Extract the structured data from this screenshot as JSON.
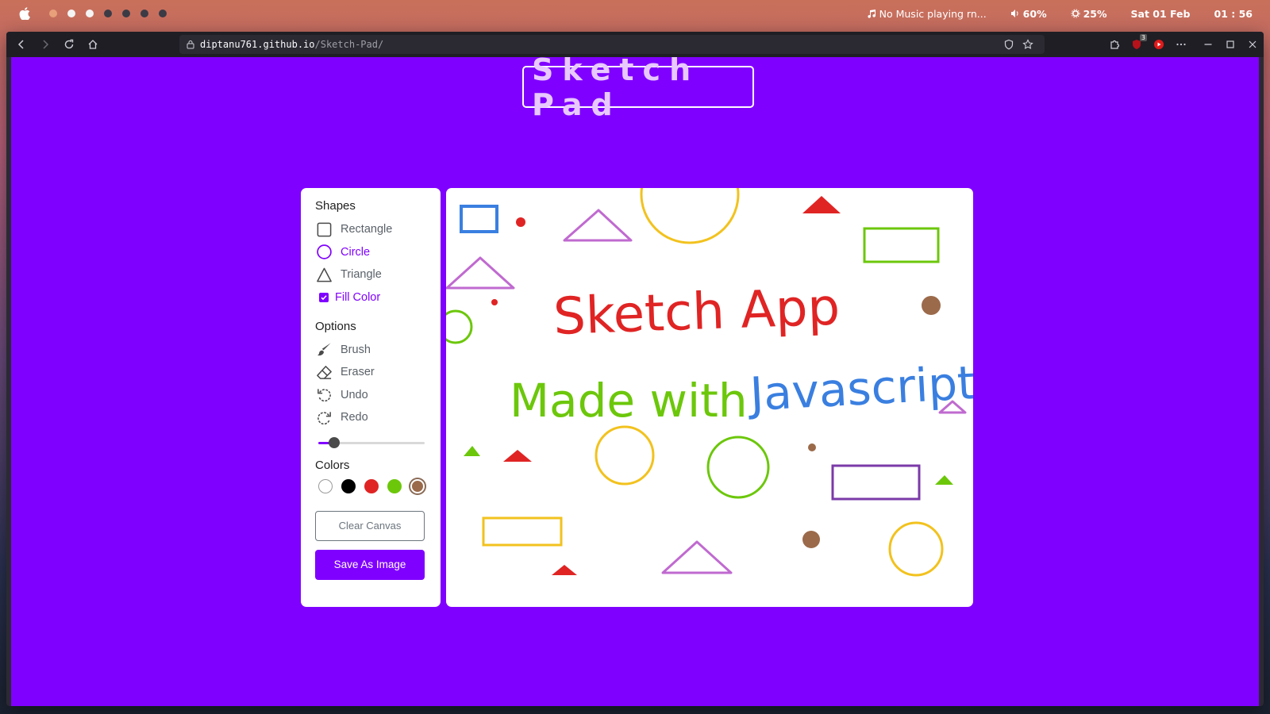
{
  "menubar": {
    "music": "No Music playing rn...",
    "volume": "60%",
    "brightness": "25%",
    "date": "Sat 01 Feb",
    "time": "01 : 56"
  },
  "browser": {
    "url_host": "diptanu761.github.io",
    "url_path": "/Sketch-Pad/",
    "extension_badge": "3"
  },
  "app": {
    "title": "Sketch Pad",
    "shapes_title": "Shapes",
    "shapes": [
      "Rectangle",
      "Circle",
      "Triangle"
    ],
    "active_shape": "Circle",
    "fill_color_label": "Fill Color",
    "fill_color_checked": true,
    "options_title": "Options",
    "options": [
      "Brush",
      "Eraser",
      "Undo",
      "Redo"
    ],
    "brush_size_fraction": 0.15,
    "colors_title": "Colors",
    "colors": [
      "#ffffff",
      "#000000",
      "#e02424",
      "#6cc70b",
      "#9b6a4a"
    ],
    "selected_color": "#9b6a4a",
    "clear_button": "Clear Canvas",
    "save_button": "Save As Image"
  },
  "canvas": {
    "handwriting_line1": "Sketch App",
    "handwriting_line2a": "Made with",
    "handwriting_line2b": "Javascript",
    "line1_color": "#e02424",
    "line2a_color": "#6cc70b",
    "line2b_color": "#3a7fe0",
    "shape_colors": {
      "blue": "#3a7fe0",
      "purple_tri": "#c06ad0",
      "yellow": "#f2c21e",
      "red": "#e02424",
      "green": "#6cc70b",
      "brown": "#9b6a4a",
      "violet_rect": "#7b3aa8"
    }
  }
}
